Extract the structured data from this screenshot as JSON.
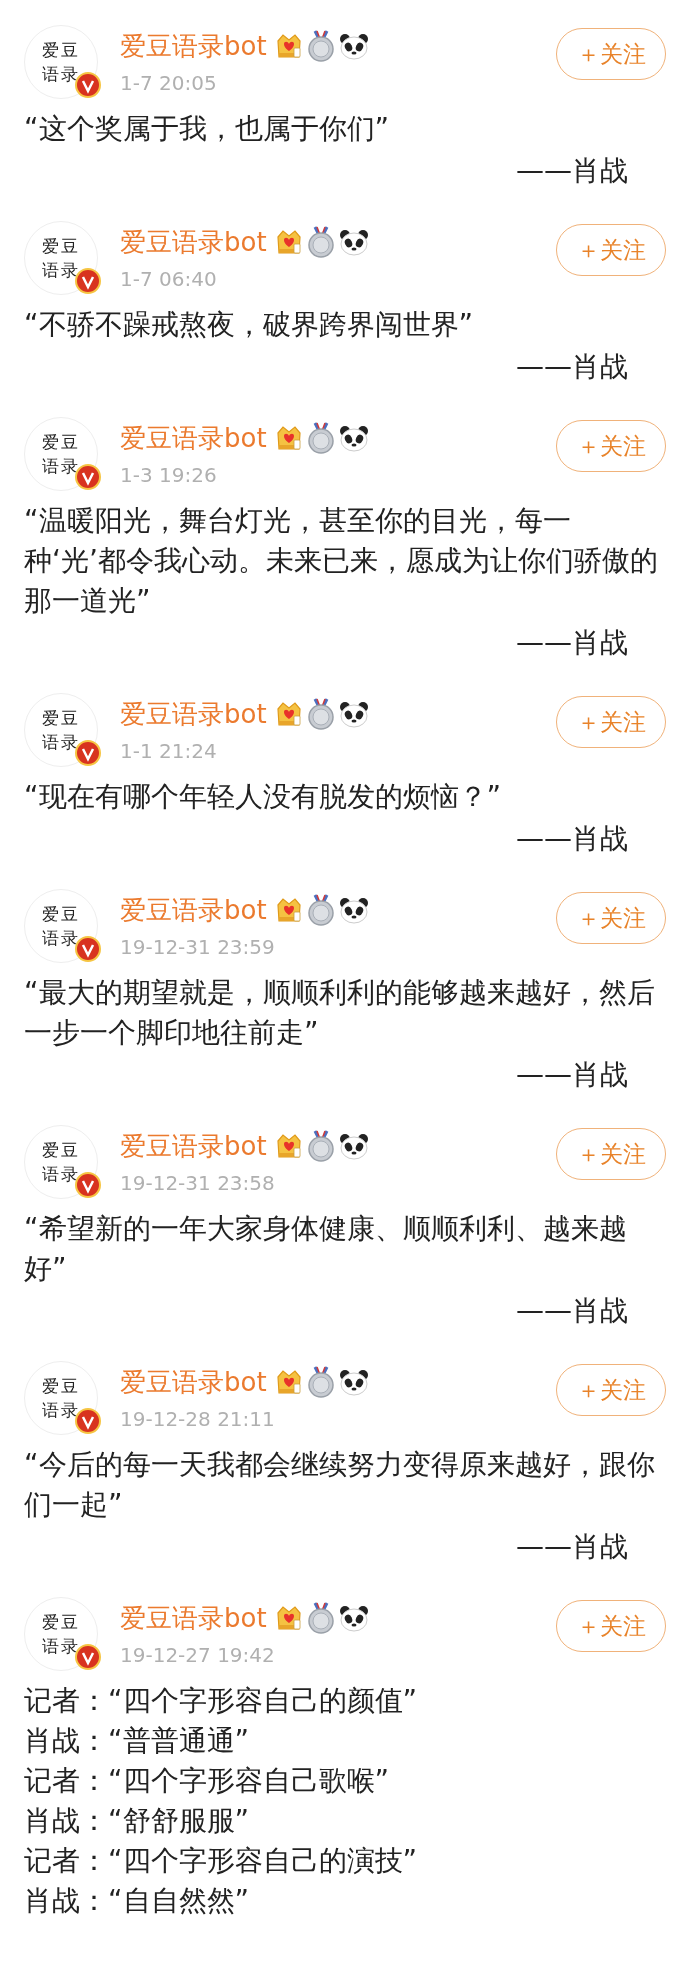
{
  "posts": [
    {
      "author": {
        "name": "爱豆语录bot",
        "avatar_lines": [
          "爱豆",
          "语录"
        ]
      },
      "time": "1-7 20:05",
      "follow_label": "＋关注",
      "body": [
        "“这个奖属于我，也属于你们”"
      ],
      "attribution": "——肖战"
    },
    {
      "author": {
        "name": "爱豆语录bot",
        "avatar_lines": [
          "爱豆",
          "语录"
        ]
      },
      "time": "1-7 06:40",
      "follow_label": "＋关注",
      "body": [
        "“不骄不躁戒熬夜，破界跨界闯世界”"
      ],
      "attribution": "——肖战"
    },
    {
      "author": {
        "name": "爱豆语录bot",
        "avatar_lines": [
          "爱豆",
          "语录"
        ]
      },
      "time": "1-3 19:26",
      "follow_label": "＋关注",
      "body": [
        "“温暖阳光，舞台灯光，甚至你的目光，每一",
        "种‘光’都令我心动。未来已来，愿成为让你们骄傲的",
        "那一道光”"
      ],
      "attribution": "——肖战"
    },
    {
      "author": {
        "name": "爱豆语录bot",
        "avatar_lines": [
          "爱豆",
          "语录"
        ]
      },
      "time": "1-1 21:24",
      "follow_label": "＋关注",
      "body": [
        "“现在有哪个年轻人没有脱发的烦恼？”"
      ],
      "attribution": "——肖战"
    },
    {
      "author": {
        "name": "爱豆语录bot",
        "avatar_lines": [
          "爱豆",
          "语录"
        ]
      },
      "time": "19-12-31 23:59",
      "follow_label": "＋关注",
      "body": [
        "“最大的期望就是，顺顺利利的能够越来越好，然后",
        "一步一个脚印地往前走”"
      ],
      "attribution": "——肖战"
    },
    {
      "author": {
        "name": "爱豆语录bot",
        "avatar_lines": [
          "爱豆",
          "语录"
        ]
      },
      "time": "19-12-31 23:58",
      "follow_label": "＋关注",
      "body": [
        "“希望新的一年大家身体健康、顺顺利利、越来越",
        "好”"
      ],
      "attribution": "——肖战"
    },
    {
      "author": {
        "name": "爱豆语录bot",
        "avatar_lines": [
          "爱豆",
          "语录"
        ]
      },
      "time": "19-12-28 21:11",
      "follow_label": "＋关注",
      "body": [
        "“今后的每一天我都会继续努力变得原来越好，跟你",
        "们一起”"
      ],
      "attribution": "——肖战"
    },
    {
      "author": {
        "name": "爱豆语录bot",
        "avatar_lines": [
          "爱豆",
          "语录"
        ]
      },
      "time": "19-12-27 19:42",
      "follow_label": "＋关注",
      "body": [
        "记者：“四个字形容自己的颜值”",
        "肖战：“普普通通”",
        "记者：“四个字形容自己歌喉”",
        "肖战：“舒舒服服”",
        "记者：“四个字形容自己的演技”",
        "肖战：“自自然然”"
      ]
    }
  ]
}
